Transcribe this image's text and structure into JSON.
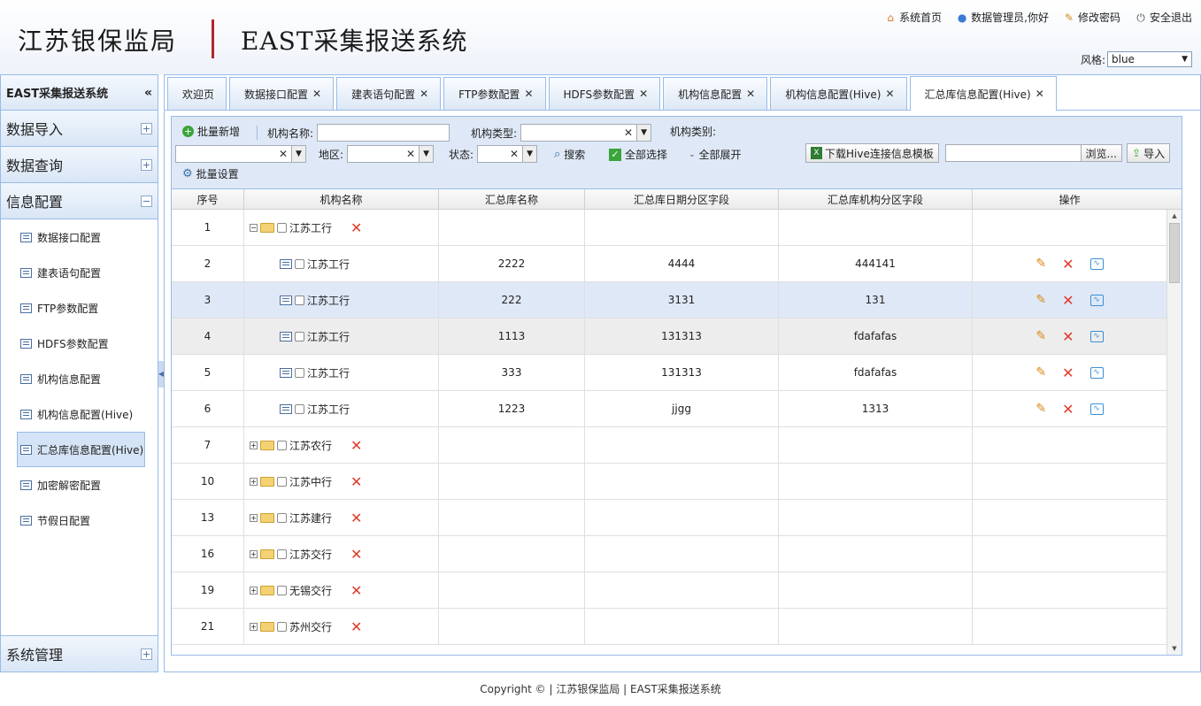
{
  "header": {
    "brand_left": "江苏银保监局",
    "brand_right": "EAST采集报送系统",
    "links": {
      "home": "系统首页",
      "user": "数据管理员,你好",
      "password": "修改密码",
      "logout": "安全退出"
    },
    "style_label": "风格:",
    "style_value": "blue"
  },
  "sidebar": {
    "title": "EAST采集报送系统",
    "sections": {
      "import": "数据导入",
      "query": "数据查询",
      "config": "信息配置",
      "system": "系统管理"
    },
    "items": [
      {
        "label": "数据接口配置"
      },
      {
        "label": "建表语句配置"
      },
      {
        "label": "FTP参数配置"
      },
      {
        "label": "HDFS参数配置"
      },
      {
        "label": "机构信息配置"
      },
      {
        "label": "机构信息配置(Hive)"
      },
      {
        "label": "汇总库信息配置(Hive)"
      },
      {
        "label": "加密解密配置"
      },
      {
        "label": "节假日配置"
      }
    ]
  },
  "tabs": [
    {
      "label": "欢迎页"
    },
    {
      "label": "数据接口配置"
    },
    {
      "label": "建表语句配置"
    },
    {
      "label": "FTP参数配置"
    },
    {
      "label": "HDFS参数配置"
    },
    {
      "label": "机构信息配置"
    },
    {
      "label": "机构信息配置(Hive)"
    },
    {
      "label": "汇总库信息配置(Hive)"
    }
  ],
  "toolbar": {
    "batch_add": "批量新增",
    "org_name_label": "机构名称:",
    "org_type_label": "机构类型:",
    "org_category_label": "机构类别:",
    "region_label": "地区:",
    "status_label": "状态:",
    "search": "搜索",
    "select_all": "全部选择",
    "expand_all": "全部展开",
    "download_template": "下载Hive连接信息模板",
    "browse": "浏览...",
    "import": "导入",
    "batch_settings": "批量设置"
  },
  "grid": {
    "columns": [
      "序号",
      "机构名称",
      "汇总库名称",
      "汇总库日期分区字段",
      "汇总库机构分区字段",
      "操作"
    ],
    "rows": [
      {
        "no": "1",
        "name": "江苏工行",
        "db": "",
        "date_field": "",
        "org_field": ""
      },
      {
        "no": "2",
        "name": "江苏工行",
        "db": "2222",
        "date_field": "4444",
        "org_field": "444141"
      },
      {
        "no": "3",
        "name": "江苏工行",
        "db": "222",
        "date_field": "3131",
        "org_field": "131"
      },
      {
        "no": "4",
        "name": "江苏工行",
        "db": "1113",
        "date_field": "131313",
        "org_field": "fdafafas"
      },
      {
        "no": "5",
        "name": "江苏工行",
        "db": "333",
        "date_field": "131313",
        "org_field": "fdafafas"
      },
      {
        "no": "6",
        "name": "江苏工行",
        "db": "1223",
        "date_field": "jjgg",
        "org_field": "1313"
      },
      {
        "no": "7",
        "name": "江苏农行",
        "db": "",
        "date_field": "",
        "org_field": ""
      },
      {
        "no": "10",
        "name": "江苏中行",
        "db": "",
        "date_field": "",
        "org_field": ""
      },
      {
        "no": "13",
        "name": "江苏建行",
        "db": "",
        "date_field": "",
        "org_field": ""
      },
      {
        "no": "16",
        "name": "江苏交行",
        "db": "",
        "date_field": "",
        "org_field": ""
      },
      {
        "no": "19",
        "name": "无锡交行",
        "db": "",
        "date_field": "",
        "org_field": ""
      },
      {
        "no": "21",
        "name": "苏州交行",
        "db": "",
        "date_field": "",
        "org_field": ""
      }
    ]
  },
  "footer": "Copyright © | 江苏银保监局 | EAST采集报送系统"
}
